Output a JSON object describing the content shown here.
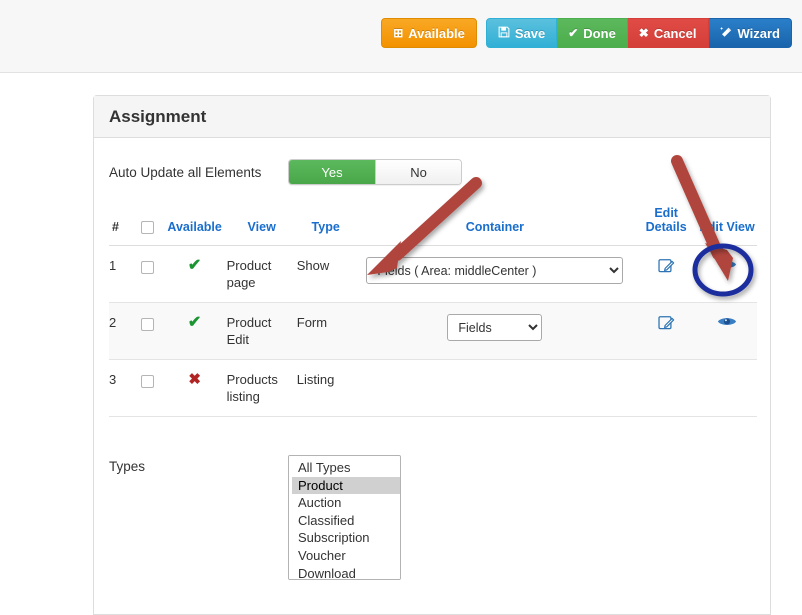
{
  "toolbar": {
    "buttons": [
      {
        "label": "Available",
        "icon": "plus-square-icon",
        "glyph": "⊞",
        "color": "#f39200"
      },
      {
        "label": "Save",
        "icon": "floppy-disk-icon",
        "glyph": "💾",
        "color": "#31b0d5"
      },
      {
        "label": "Done",
        "icon": "check-icon",
        "glyph": "✔",
        "color": "#5cb85c"
      },
      {
        "label": "Cancel",
        "icon": "times-icon",
        "glyph": "✖",
        "color": "#d43f3a"
      },
      {
        "label": "Wizard",
        "icon": "magic-wand-icon",
        "glyph": "✦",
        "color": "#1964ab"
      }
    ]
  },
  "panel": {
    "title": "Assignment"
  },
  "auto_update": {
    "label": "Auto Update all Elements",
    "yes_label": "Yes",
    "no_label": "No",
    "selected": "Yes"
  },
  "table": {
    "headers": {
      "num": "#",
      "select_all": "",
      "available": "Available",
      "view": "View",
      "type": "Type",
      "container": "Container",
      "edit_details": "Edit Details",
      "edit_view": "Edit View"
    },
    "rows": [
      {
        "num": "1",
        "checked": false,
        "available": "yes",
        "available_glyph": "✔",
        "view": "Product page",
        "type": "Show",
        "container_value": "Fields ( Area: middleCenter )",
        "container_options": [
          "Fields ( Area: middleCenter )"
        ],
        "has_container": true,
        "has_edit_details": true,
        "has_edit_view": true
      },
      {
        "num": "2",
        "checked": false,
        "available": "yes",
        "available_glyph": "✔",
        "view": "Product Edit",
        "type": "Form",
        "container_value": "Fields",
        "container_options": [
          "Fields"
        ],
        "has_container": true,
        "has_edit_details": true,
        "has_edit_view": true
      },
      {
        "num": "3",
        "checked": false,
        "available": "no",
        "available_glyph": "✖",
        "view": "Products listing",
        "type": "Listing",
        "container_value": "",
        "container_options": [],
        "has_container": false,
        "has_edit_details": false,
        "has_edit_view": false
      }
    ]
  },
  "types": {
    "label": "Types",
    "options": [
      "All Types",
      "Product",
      "Auction",
      "Classified",
      "Subscription",
      "Voucher",
      "Download"
    ],
    "selected": "Product"
  },
  "annotations": {
    "arrow_color": "#b0443c",
    "highlight_color": "#1b2f9e",
    "arrow_one_target": "container-dropdown-row-1",
    "arrow_two_target": "edit-view-icon-row-1",
    "ellipse_target": "edit-view-icon-row-1"
  }
}
